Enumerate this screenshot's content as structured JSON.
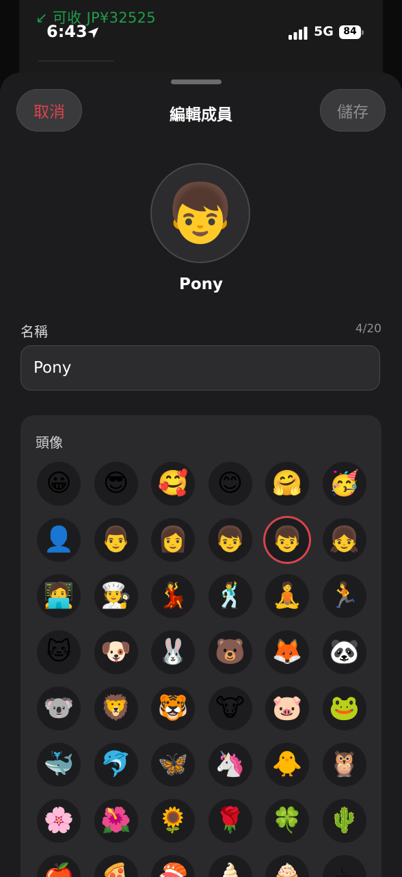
{
  "status_bar": {
    "income": "↙ 可收 JP¥32525",
    "time": "6:43",
    "network": "5G",
    "battery": "84"
  },
  "sheet": {
    "cancel_label": "取消",
    "title": "編輯成員",
    "save_label": "儲存",
    "avatar_emoji": "👦",
    "member_name": "Pony",
    "name_label": "名稱",
    "char_count": "4/20",
    "name_value": "Pony"
  },
  "avatar_picker": {
    "title": "頭像",
    "selected_emoji": "👦",
    "accent_color": "#d8444c",
    "rows": [
      [
        "😀",
        "😎",
        "🥰",
        "😊",
        "🤗",
        "🥳"
      ],
      [
        "👤",
        "👨",
        "👩",
        "👦",
        "👦",
        "👧"
      ],
      [
        "🧑‍💻",
        "🧑‍🍳",
        "💃",
        "🕺",
        "🧘",
        "🏃"
      ],
      [
        "🐱",
        "🐶",
        "🐰",
        "🐻",
        "🦊",
        "🐼"
      ],
      [
        "🐨",
        "🦁",
        "🐯",
        "🐮",
        "🐷",
        "🐸"
      ],
      [
        "🐳",
        "🐬",
        "🦋",
        "🦄",
        "🐥",
        "🦉"
      ],
      [
        "🌸",
        "🌺",
        "🌻",
        "🌹",
        "🍀",
        "🌵"
      ],
      [
        "🍎",
        "🍕",
        "🍣",
        "🍦",
        "🧁",
        "☕"
      ]
    ],
    "selected_position": [
      1,
      4
    ]
  }
}
